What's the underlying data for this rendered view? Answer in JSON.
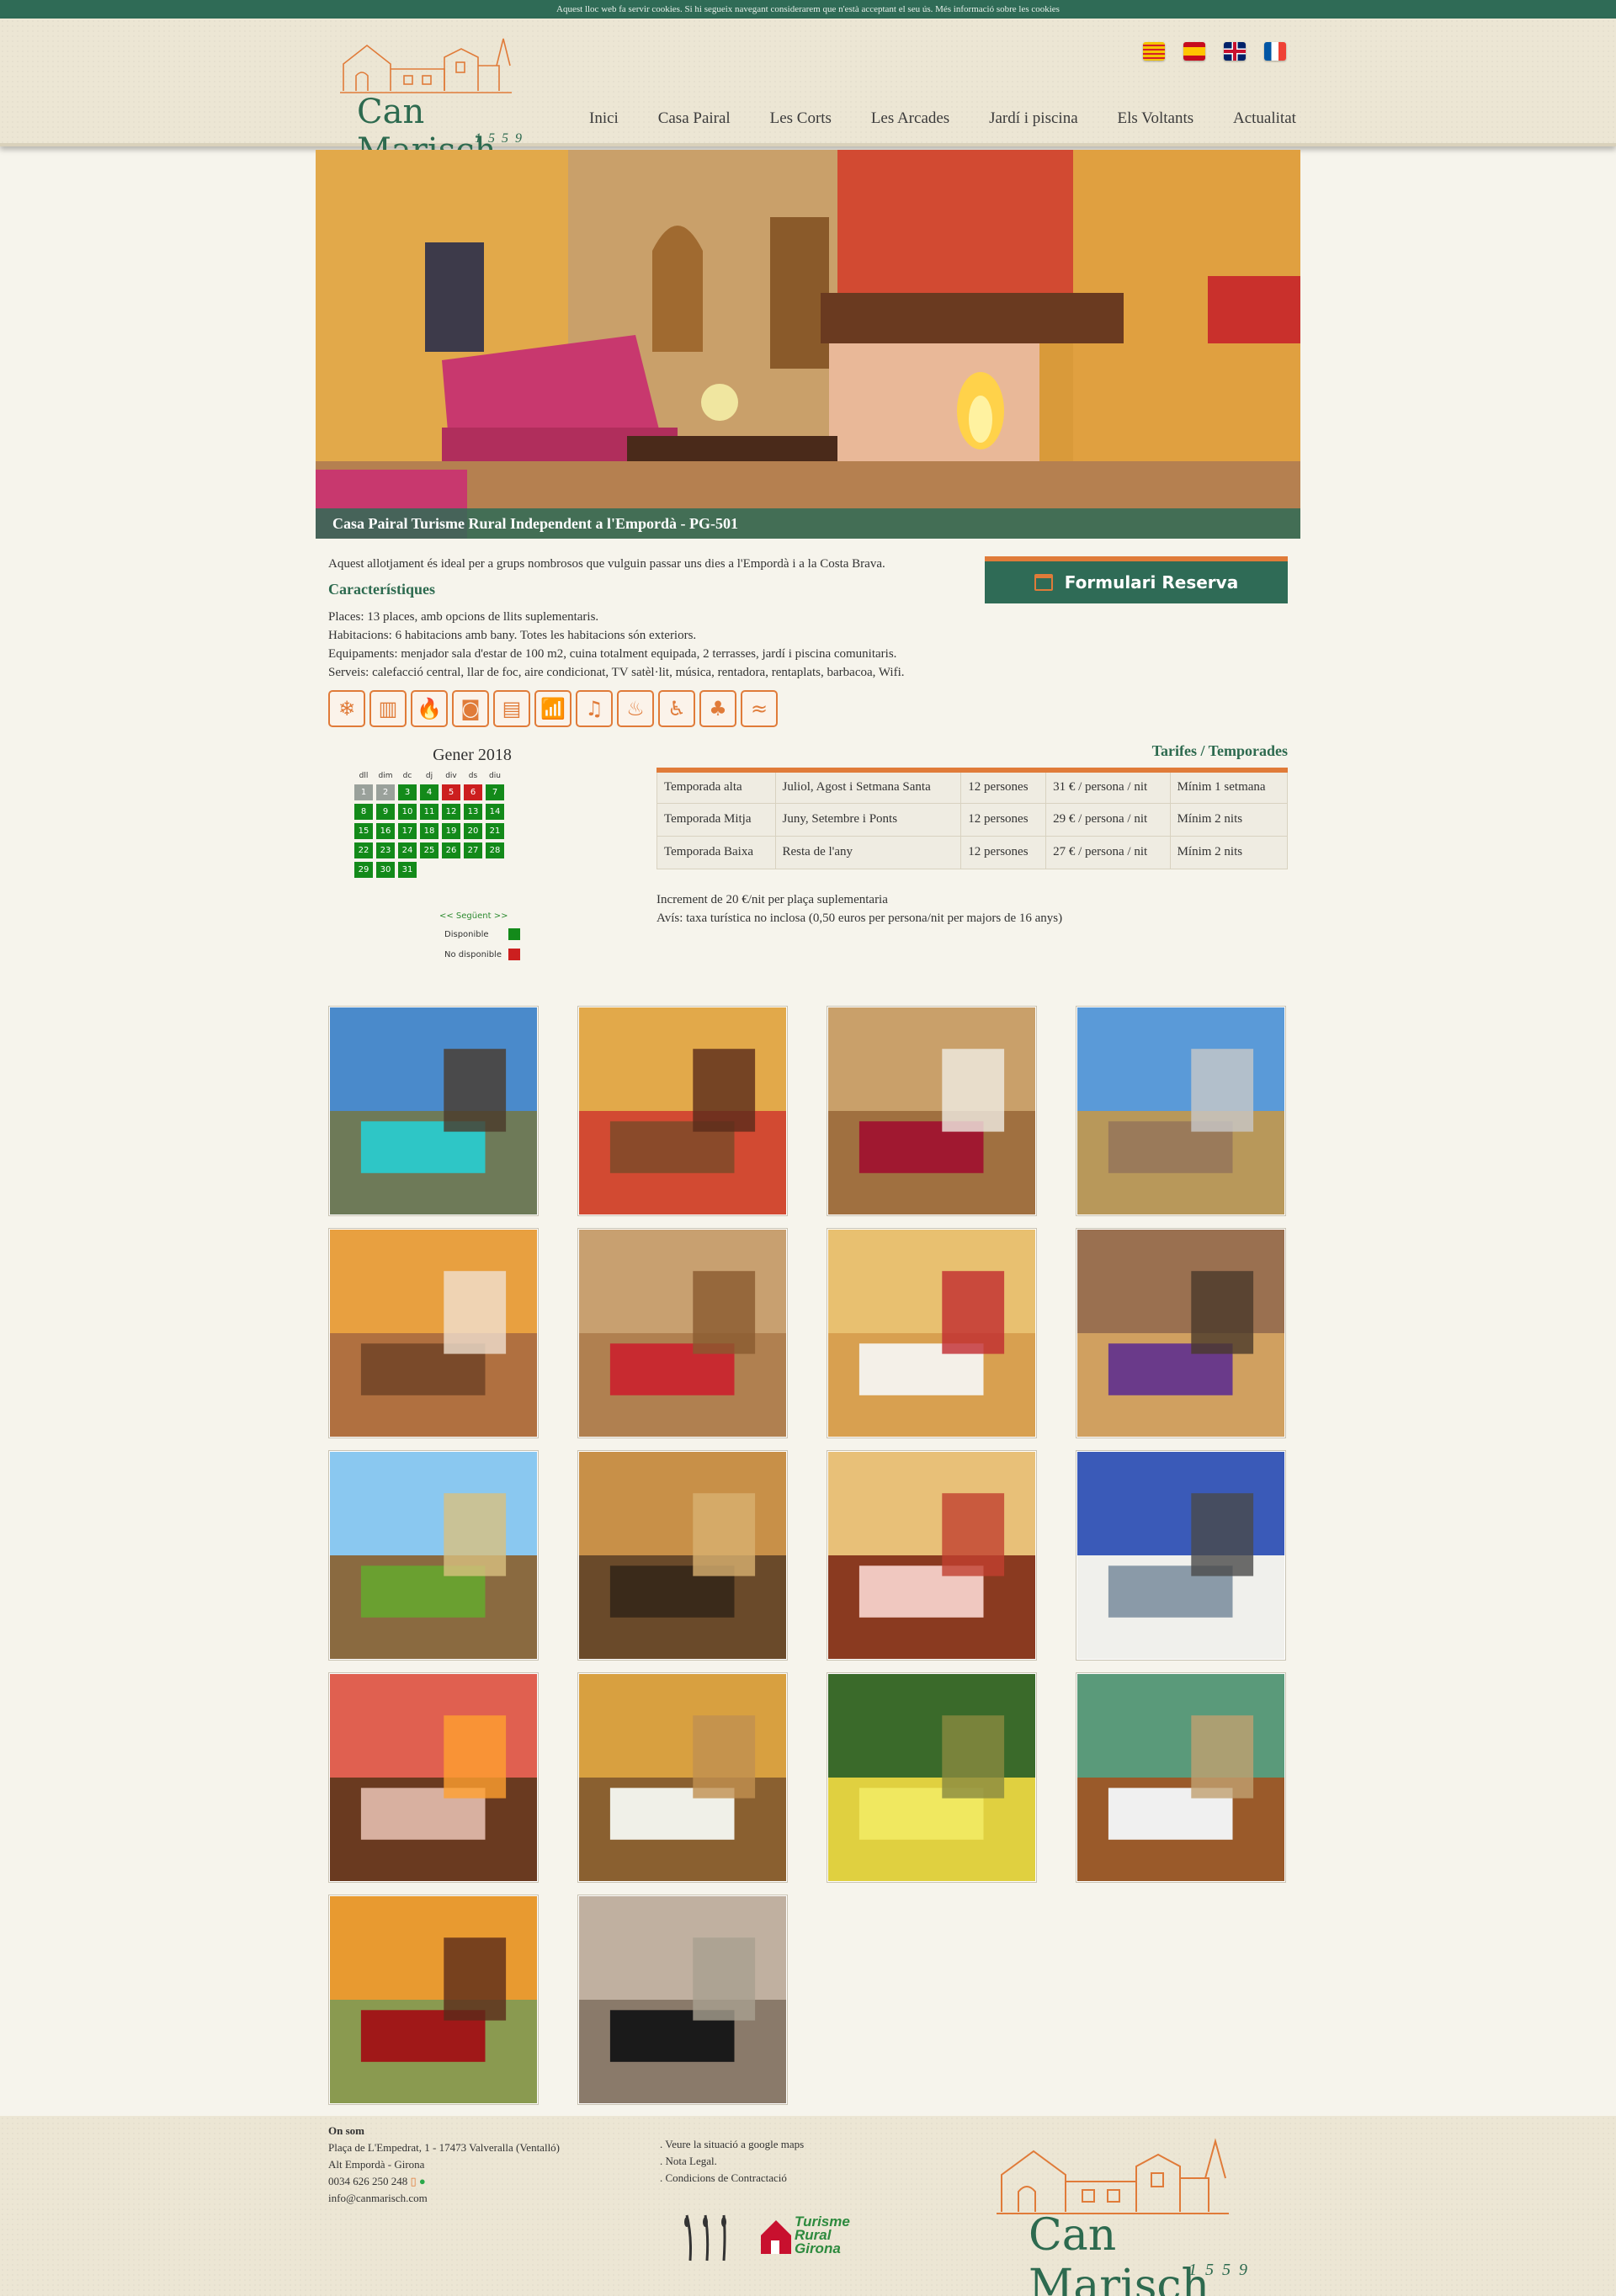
{
  "cookie_bar": {
    "text": "Aquest lloc web fa servir cookies. Si hi segueix navegant considerarem que n'està acceptant el seu ús. Més informació sobre les cookies"
  },
  "header": {
    "logo_name": "Can Marisch",
    "logo_year": "1559",
    "flags": [
      "ca",
      "es",
      "en",
      "fr"
    ],
    "nav": [
      "Inici",
      "Casa Pairal",
      "Les Corts",
      "Les Arcades",
      "Jardí i piscina",
      "Els Voltants",
      "Actualitat"
    ]
  },
  "hero": {
    "caption": "Casa Pairal Turisme Rural Independent a l'Empordà - PG-501"
  },
  "intro": "Aquest allotjament és ideal per a grups nombrosos que vulguin passar uns dies a l'Empordà i a la Costa Brava.",
  "features": {
    "title": "Característiques",
    "lines": [
      "Places: 13 places, amb opcions de llits suplementaris.",
      "Habitacions: 6 habitacions amb bany. Totes les habitacions són exteriors.",
      "Equipaments: menjador sala d'estar de 100 m2, cuina totalment equipada, 2 terrasses, jardí i piscina comunitaris.",
      "Serveis: calefacció central, llar de foc, aire condicionat, TV satèl·lit, música, rentadora, rentaplats, barbacoa, Wifi."
    ]
  },
  "reserve_button": "Formulari Reserva",
  "amenities": [
    {
      "name": "air-conditioning-icon",
      "glyph": "❄"
    },
    {
      "name": "heating-icon",
      "glyph": "▥"
    },
    {
      "name": "fireplace-icon",
      "glyph": "🔥"
    },
    {
      "name": "washing-machine-icon",
      "glyph": "◙"
    },
    {
      "name": "dishwasher-icon",
      "glyph": "▤"
    },
    {
      "name": "wifi-icon",
      "glyph": "📶"
    },
    {
      "name": "music-icon",
      "glyph": "♫"
    },
    {
      "name": "barbecue-icon",
      "glyph": "♨"
    },
    {
      "name": "accessible-icon",
      "glyph": "♿"
    },
    {
      "name": "garden-icon",
      "glyph": "♣"
    },
    {
      "name": "pool-icon",
      "glyph": "≈"
    }
  ],
  "calendar": {
    "title": "Gener 2018",
    "weekdays": [
      "dll",
      "dim",
      "dc",
      "dj",
      "div",
      "ds",
      "diu"
    ],
    "days": [
      {
        "n": "1",
        "s": "past"
      },
      {
        "n": "2",
        "s": "past"
      },
      {
        "n": "3",
        "s": "av"
      },
      {
        "n": "4",
        "s": "av"
      },
      {
        "n": "5",
        "s": "na"
      },
      {
        "n": "6",
        "s": "na"
      },
      {
        "n": "7",
        "s": "av"
      },
      {
        "n": "8",
        "s": "av"
      },
      {
        "n": "9",
        "s": "av"
      },
      {
        "n": "10",
        "s": "av"
      },
      {
        "n": "11",
        "s": "av"
      },
      {
        "n": "12",
        "s": "av"
      },
      {
        "n": "13",
        "s": "av"
      },
      {
        "n": "14",
        "s": "av"
      },
      {
        "n": "15",
        "s": "av"
      },
      {
        "n": "16",
        "s": "av"
      },
      {
        "n": "17",
        "s": "av"
      },
      {
        "n": "18",
        "s": "av"
      },
      {
        "n": "19",
        "s": "av"
      },
      {
        "n": "20",
        "s": "av"
      },
      {
        "n": "21",
        "s": "av"
      },
      {
        "n": "22",
        "s": "av"
      },
      {
        "n": "23",
        "s": "av"
      },
      {
        "n": "24",
        "s": "av"
      },
      {
        "n": "25",
        "s": "av"
      },
      {
        "n": "26",
        "s": "av"
      },
      {
        "n": "27",
        "s": "av"
      },
      {
        "n": "28",
        "s": "av"
      },
      {
        "n": "29",
        "s": "av"
      },
      {
        "n": "30",
        "s": "av"
      },
      {
        "n": "31",
        "s": "av"
      }
    ],
    "next_link": "<< Següent >>",
    "legend_available": "Disponible",
    "legend_unavailable": "No disponible",
    "colors": {
      "available": "#138a1a",
      "unavailable": "#cc1f1f",
      "past": "#9aa19b"
    }
  },
  "rates": {
    "title": "Tarifes / Temporades",
    "rows": [
      [
        "Temporada alta",
        "Juliol, Agost i Setmana Santa",
        "12 persones",
        "31 € / persona / nit",
        "Mínim 1 setmana"
      ],
      [
        "Temporada Mitja",
        "Juny, Setembre i Ponts",
        "12 persones",
        "29 € / persona / nit",
        "Mínim 2 nits"
      ],
      [
        "Temporada Baixa",
        "Resta de l'any",
        "12 persones",
        "27 € / persona / nit",
        "Mínim 2 nits"
      ]
    ],
    "notes": [
      "Increment de 20 €/nit per plaça suplementaria",
      "Avís: taxa turística no inclosa (0,50 euros per persona/nit per majors de 16 anys)"
    ]
  },
  "gallery": [
    "pool",
    "living-room-fireplace",
    "vaulted-bedroom",
    "terrace",
    "bedroom-wooden-bed",
    "arched-living-room",
    "bedroom-white",
    "dining-living-room",
    "garden-house",
    "staircase-dining",
    "bedroom-pink",
    "kitchen",
    "fireplace",
    "patio-furniture",
    "bathroom-sink",
    "twin-bedroom",
    "red-sofa-room",
    "stone-archway"
  ],
  "footer": {
    "heading": "On som",
    "address": "Plaça de L'Empedrat, 1 - 17473 Valveralla (Ventalló)",
    "region": "Alt Empordà - Girona",
    "phone": "0034 626 250 248",
    "email": "info@canmarisch.com",
    "links": [
      ". Veure la situació a google maps",
      ". Nota Legal.",
      ". Condicions de Contractació"
    ],
    "partner_line1": "Turisme",
    "partner_line2": "Rural",
    "partner_line3": "Girona",
    "logo_name": "Can Marisch",
    "logo_year": "1559"
  }
}
